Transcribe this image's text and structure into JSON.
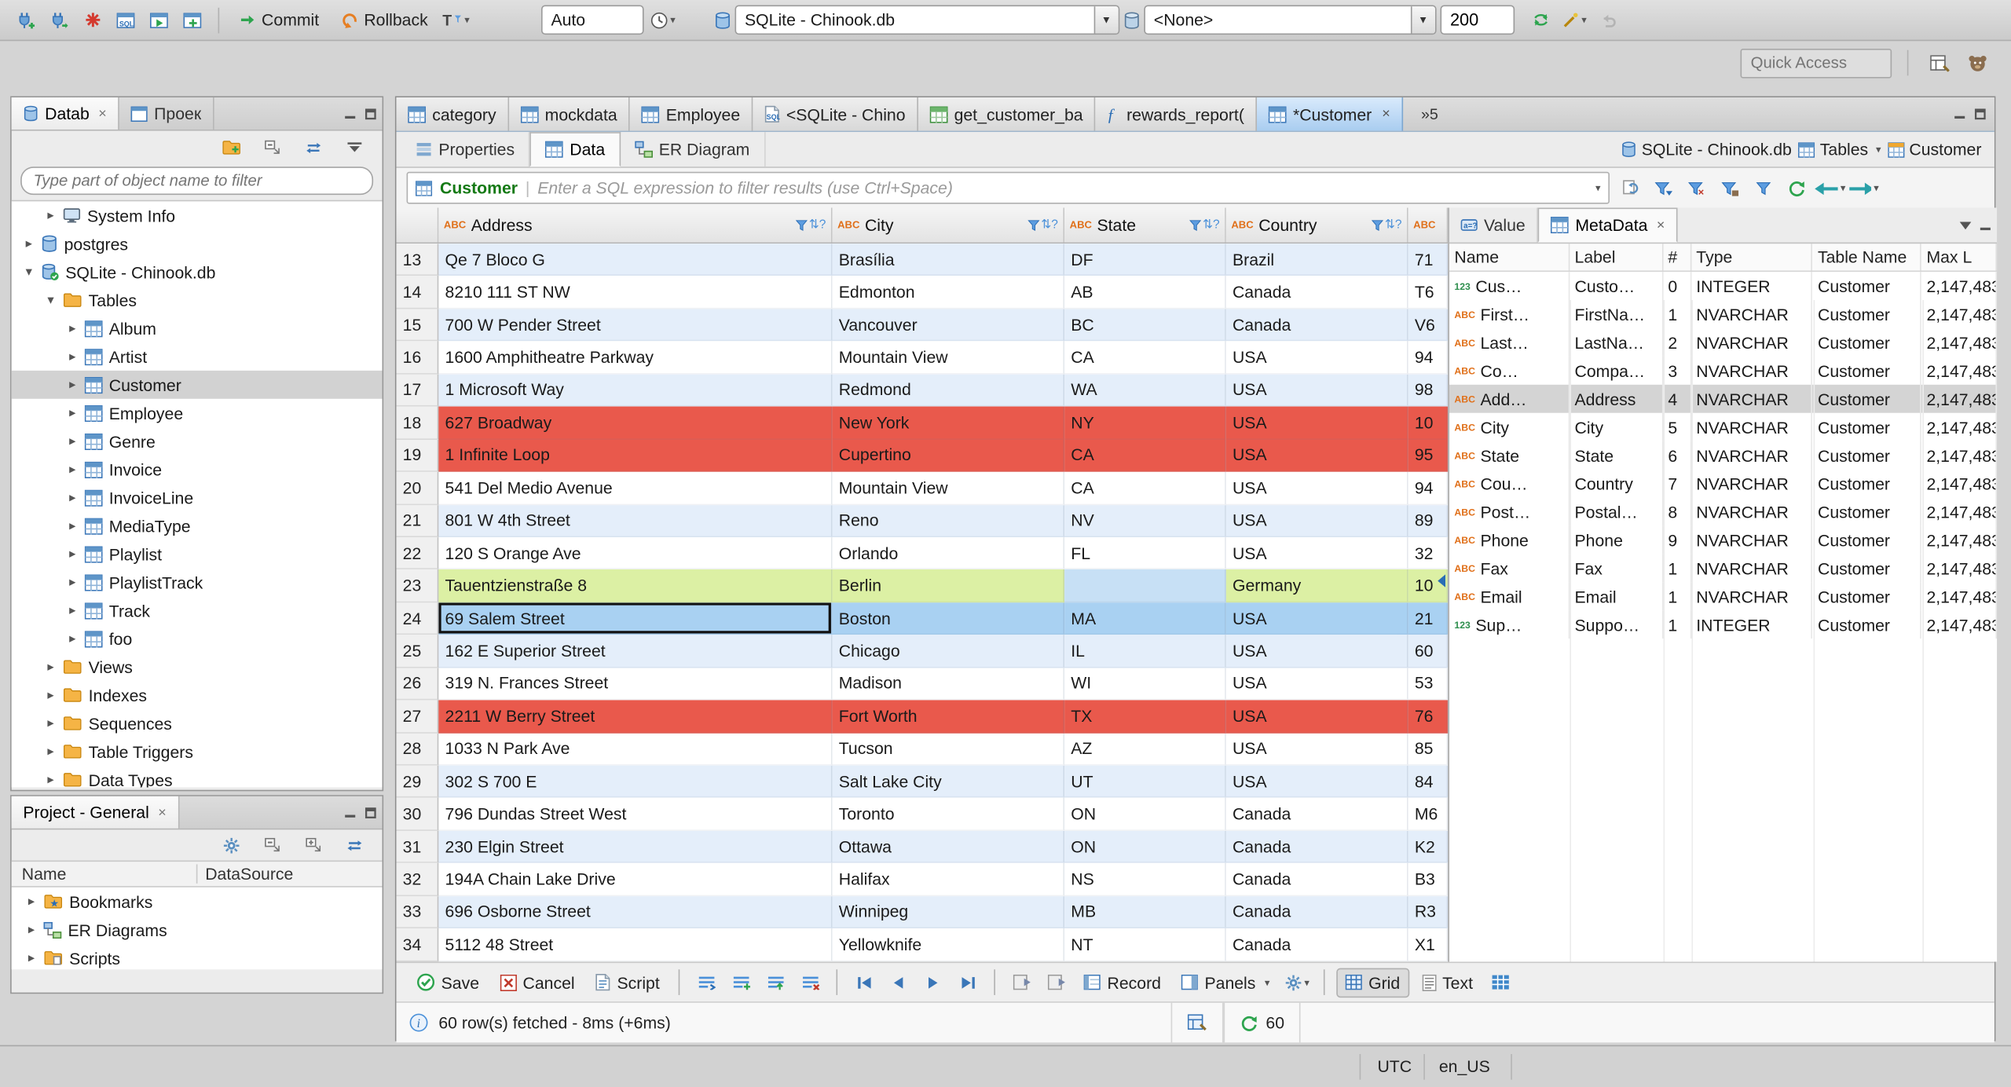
{
  "window": {
    "status": {
      "timezone": "UTC",
      "locale": "en_US"
    }
  },
  "main_toolbar": {
    "left_icons": [
      {
        "icon": "new-connection"
      },
      {
        "icon": "connect-database"
      },
      {
        "icon": "disconnect-database"
      },
      {
        "icon": "new-sql-editor"
      },
      {
        "icon": "open-recent-sql-editor"
      },
      {
        "icon": "new-sql-script"
      }
    ],
    "commit_label": "Commit",
    "rollback_label": "Rollback",
    "transaction_filter_icon": "transaction-filter",
    "auto_commit_value": "Auto",
    "transaction_log_icon": "transaction-log",
    "database_combo_value": "SQLite - Chinook.db",
    "schema_combo_value": "<None>",
    "fetch_size_value": "200",
    "right_icons": [
      {
        "icon": "sync-with-navigator"
      },
      {
        "icon": "sql-assist",
        "dropdown": true
      },
      {
        "icon": "undo",
        "disabled": true
      }
    ],
    "quick_access_placeholder": "Quick Access",
    "perspective_icons": [
      {
        "icon": "open-perspective"
      },
      {
        "icon": "dbeaver-perspective"
      }
    ]
  },
  "navigator": {
    "database_tab": "Datab",
    "projects_tab": "Проек",
    "toolbar_icons": [
      {
        "icon": "new-folder"
      },
      {
        "icon": "collapse-all"
      },
      {
        "icon": "link-with-editor"
      },
      {
        "icon": "view-menu"
      }
    ],
    "filter_placeholder": "Type part of object name to filter",
    "tree": [
      {
        "depth": 1,
        "arrow": "right",
        "icon": "system-info",
        "label": "System Info"
      },
      {
        "depth": 0,
        "arrow": "right",
        "icon": "postgres-database",
        "label": "postgres"
      },
      {
        "depth": 0,
        "arrow": "down",
        "icon": "sqlite-database",
        "label": "SQLite - Chinook.db"
      },
      {
        "depth": 1,
        "arrow": "down",
        "icon": "folder",
        "label": "Tables"
      },
      {
        "depth": 2,
        "arrow": "right",
        "icon": "table",
        "label": "Album"
      },
      {
        "depth": 2,
        "arrow": "right",
        "icon": "table",
        "label": "Artist"
      },
      {
        "depth": 2,
        "arrow": "right",
        "icon": "table",
        "label": "Customer",
        "selected": true
      },
      {
        "depth": 2,
        "arrow": "right",
        "icon": "table",
        "label": "Employee"
      },
      {
        "depth": 2,
        "arrow": "right",
        "icon": "table",
        "label": "Genre"
      },
      {
        "depth": 2,
        "arrow": "right",
        "icon": "table",
        "label": "Invoice"
      },
      {
        "depth": 2,
        "arrow": "right",
        "icon": "table",
        "label": "InvoiceLine"
      },
      {
        "depth": 2,
        "arrow": "right",
        "icon": "table",
        "label": "MediaType"
      },
      {
        "depth": 2,
        "arrow": "right",
        "icon": "table",
        "label": "Playlist"
      },
      {
        "depth": 2,
        "arrow": "right",
        "icon": "table",
        "label": "PlaylistTrack"
      },
      {
        "depth": 2,
        "arrow": "right",
        "icon": "table",
        "label": "Track"
      },
      {
        "depth": 2,
        "arrow": "right",
        "icon": "table",
        "label": "foo"
      },
      {
        "depth": 1,
        "arrow": "right",
        "icon": "folder",
        "label": "Views"
      },
      {
        "depth": 1,
        "arrow": "right",
        "icon": "folder",
        "label": "Indexes"
      },
      {
        "depth": 1,
        "arrow": "right",
        "icon": "folder",
        "label": "Sequences"
      },
      {
        "depth": 1,
        "arrow": "right",
        "icon": "folder",
        "label": "Table Triggers"
      },
      {
        "depth": 1,
        "arrow": "right",
        "icon": "folder",
        "label": "Data Types"
      }
    ]
  },
  "project_panel": {
    "title": "Project - General",
    "toolbar_icons": [
      {
        "icon": "settings"
      },
      {
        "icon": "collapse-all"
      },
      {
        "icon": "expand-all"
      },
      {
        "icon": "link-with-editor"
      }
    ],
    "columns": [
      "Name",
      "DataSource"
    ],
    "items": [
      {
        "icon": "bookmarks-folder",
        "label": "Bookmarks"
      },
      {
        "icon": "er-diagrams",
        "label": "ER Diagrams"
      },
      {
        "icon": "scripts-folder",
        "label": "Scripts"
      }
    ]
  },
  "editor": {
    "tabs": [
      {
        "icon": "table",
        "label": "category"
      },
      {
        "icon": "table",
        "label": "mockdata"
      },
      {
        "icon": "table",
        "label": "Employee"
      },
      {
        "icon": "sql",
        "label": "<SQLite - Chino"
      },
      {
        "icon": "view",
        "label": "get_customer_ba"
      },
      {
        "icon": "function",
        "label": "rewards_report("
      },
      {
        "icon": "table",
        "label": "*Customer",
        "active": true,
        "closable": true
      }
    ],
    "tab_overflow": "»5",
    "subtabs": [
      {
        "icon": "properties",
        "label": "Properties"
      },
      {
        "icon": "data",
        "label": "Data",
        "active": true
      },
      {
        "icon": "er-diagram",
        "label": "ER Diagram"
      }
    ],
    "context": {
      "database": "SQLite - Chinook.db",
      "container": "Tables",
      "entity": "Customer"
    },
    "filter": {
      "entity": "Customer",
      "placeholder": "Enter a SQL expression to filter results (use Ctrl+Space)",
      "icons": [
        {
          "icon": "expression-history"
        },
        {
          "icon": "apply-filter"
        },
        {
          "icon": "remove-filter"
        },
        {
          "icon": "save-filter"
        },
        {
          "icon": "filters-menu"
        },
        {
          "icon": "refresh-results"
        },
        {
          "icon": "results-back",
          "dropdown": true
        },
        {
          "icon": "results-forward",
          "dropdown": true
        }
      ]
    },
    "grid": {
      "columns": [
        {
          "type": "ABC",
          "name": "Address"
        },
        {
          "type": "ABC",
          "name": "City"
        },
        {
          "type": "ABC",
          "name": "State"
        },
        {
          "type": "ABC",
          "name": "Country"
        },
        {
          "type": "ABC",
          "name": ""
        }
      ],
      "rows": [
        {
          "num": 13,
          "style": "alt",
          "cells": [
            "Qe 7 Bloco G",
            "Brasília",
            "DF",
            "Brazil",
            "71"
          ]
        },
        {
          "num": 14,
          "style": "normal",
          "cells": [
            "8210 111 ST NW",
            "Edmonton",
            "AB",
            "Canada",
            "T6"
          ]
        },
        {
          "num": 15,
          "style": "alt",
          "cells": [
            "700 W Pender Street",
            "Vancouver",
            "BC",
            "Canada",
            "V6"
          ]
        },
        {
          "num": 16,
          "style": "normal",
          "cells": [
            "1600 Amphitheatre Parkway",
            "Mountain View",
            "CA",
            "USA",
            "94"
          ]
        },
        {
          "num": 17,
          "style": "alt",
          "cells": [
            "1 Microsoft Way",
            "Redmond",
            "WA",
            "USA",
            "98"
          ]
        },
        {
          "num": 18,
          "style": "red",
          "cells": [
            "627 Broadway",
            "New York",
            "NY",
            "USA",
            "10"
          ]
        },
        {
          "num": 19,
          "style": "red",
          "cells": [
            "1 Infinite Loop",
            "Cupertino",
            "CA",
            "USA",
            "95"
          ]
        },
        {
          "num": 20,
          "style": "normal",
          "cells": [
            "541 Del Medio Avenue",
            "Mountain View",
            "CA",
            "USA",
            "94"
          ]
        },
        {
          "num": 21,
          "style": "alt",
          "cells": [
            "801 W 4th Street",
            "Reno",
            "NV",
            "USA",
            "89"
          ]
        },
        {
          "num": 22,
          "style": "normal",
          "cells": [
            "120 S Orange Ave",
            "Orlando",
            "FL",
            "USA",
            "32"
          ]
        },
        {
          "num": 23,
          "style": "green",
          "cells": [
            "Tauentzienstraße 8",
            "Berlin",
            "",
            "Germany",
            "10"
          ],
          "cell_styles": {
            "2": "cell-null"
          }
        },
        {
          "num": 24,
          "style": "selected",
          "cells": [
            "69 Salem Street",
            "Boston",
            "MA",
            "USA",
            "21"
          ],
          "cell_styles": {
            "0": "cell-focus"
          }
        },
        {
          "num": 25,
          "style": "alt",
          "cells": [
            "162 E Superior Street",
            "Chicago",
            "IL",
            "USA",
            "60"
          ]
        },
        {
          "num": 26,
          "style": "normal",
          "cells": [
            "319 N. Frances Street",
            "Madison",
            "WI",
            "USA",
            "53"
          ]
        },
        {
          "num": 27,
          "style": "red",
          "cells": [
            "2211 W Berry Street",
            "Fort Worth",
            "TX",
            "USA",
            "76"
          ]
        },
        {
          "num": 28,
          "style": "normal",
          "cells": [
            "1033 N Park Ave",
            "Tucson",
            "AZ",
            "USA",
            "85"
          ]
        },
        {
          "num": 29,
          "style": "alt",
          "cells": [
            "302 S 700 E",
            "Salt Lake City",
            "UT",
            "USA",
            "84"
          ]
        },
        {
          "num": 30,
          "style": "normal",
          "cells": [
            "796 Dundas Street West",
            "Toronto",
            "ON",
            "Canada",
            "M6"
          ]
        },
        {
          "num": 31,
          "style": "alt",
          "cells": [
            "230 Elgin Street",
            "Ottawa",
            "ON",
            "Canada",
            "K2"
          ]
        },
        {
          "num": 32,
          "style": "normal",
          "cells": [
            "194A Chain Lake Drive",
            "Halifax",
            "NS",
            "Canada",
            "B3"
          ]
        },
        {
          "num": 33,
          "style": "alt",
          "cells": [
            "696 Osborne Street",
            "Winnipeg",
            "MB",
            "Canada",
            "R3"
          ]
        },
        {
          "num": 34,
          "style": "normal",
          "cells": [
            "5112 48 Street",
            "Yellowknife",
            "NT",
            "Canada",
            "X1"
          ]
        }
      ]
    },
    "side_panel": {
      "tabs": [
        {
          "icon": "value-viewer",
          "label": "Value"
        },
        {
          "icon": "metadata-grid",
          "label": "MetaData",
          "active": true,
          "closable": true
        }
      ],
      "columns": [
        "Name",
        "Label",
        "#",
        "Type",
        "Table Name",
        "Max L"
      ],
      "rows": [
        {
          "icon": "123",
          "name": "Cus…",
          "label": "Custo…",
          "num": "0",
          "type": "INTEGER",
          "table": "Customer",
          "max": "2,147,483"
        },
        {
          "icon": "ABC",
          "name": "First…",
          "label": "FirstNa…",
          "num": "1",
          "type": "NVARCHAR",
          "table": "Customer",
          "max": "2,147,483"
        },
        {
          "icon": "ABC",
          "name": "Last…",
          "label": "LastNa…",
          "num": "2",
          "type": "NVARCHAR",
          "table": "Customer",
          "max": "2,147,483"
        },
        {
          "icon": "ABC",
          "name": "Co…",
          "label": "Compa…",
          "num": "3",
          "type": "NVARCHAR",
          "table": "Customer",
          "max": "2,147,483"
        },
        {
          "icon": "ABC",
          "name": "Add…",
          "label": "Address",
          "num": "4",
          "type": "NVARCHAR",
          "table": "Customer",
          "max": "2,147,483",
          "selected": true
        },
        {
          "icon": "ABC",
          "name": "City",
          "label": "City",
          "num": "5",
          "type": "NVARCHAR",
          "table": "Customer",
          "max": "2,147,483"
        },
        {
          "icon": "ABC",
          "name": "State",
          "label": "State",
          "num": "6",
          "type": "NVARCHAR",
          "table": "Customer",
          "max": "2,147,483"
        },
        {
          "icon": "ABC",
          "name": "Cou…",
          "label": "Country",
          "num": "7",
          "type": "NVARCHAR",
          "table": "Customer",
          "max": "2,147,483"
        },
        {
          "icon": "ABC",
          "name": "Post…",
          "label": "Postal…",
          "num": "8",
          "type": "NVARCHAR",
          "table": "Customer",
          "max": "2,147,483"
        },
        {
          "icon": "ABC",
          "name": "Phone",
          "label": "Phone",
          "num": "9",
          "type": "NVARCHAR",
          "table": "Customer",
          "max": "2,147,483"
        },
        {
          "icon": "ABC",
          "name": "Fax",
          "label": "Fax",
          "num": "1",
          "type": "NVARCHAR",
          "table": "Customer",
          "max": "2,147,483"
        },
        {
          "icon": "ABC",
          "name": "Email",
          "label": "Email",
          "num": "1",
          "type": "NVARCHAR",
          "table": "Customer",
          "max": "2,147,483"
        },
        {
          "icon": "123",
          "name": "Sup…",
          "label": "Suppo…",
          "num": "1",
          "type": "INTEGER",
          "table": "Customer",
          "max": "2,147,483"
        }
      ]
    },
    "result_toolbar": {
      "items": [
        {
          "type": "button",
          "icon": "save",
          "label": "Save"
        },
        {
          "type": "button",
          "icon": "cancel",
          "label": "Cancel"
        },
        {
          "type": "button",
          "icon": "script",
          "label": "Script"
        },
        {
          "type": "sep"
        },
        {
          "type": "icon",
          "icon": "edit-value"
        },
        {
          "type": "icon",
          "icon": "add-row"
        },
        {
          "type": "icon",
          "icon": "duplicate-row"
        },
        {
          "type": "icon",
          "icon": "delete-row"
        },
        {
          "type": "sep"
        },
        {
          "type": "icon",
          "icon": "first-row"
        },
        {
          "type": "icon",
          "icon": "previous-row"
        },
        {
          "type": "icon",
          "icon": "next-row"
        },
        {
          "type": "icon",
          "icon": "last-row"
        },
        {
          "type": "sep"
        },
        {
          "type": "icon",
          "icon": "fetch-next-page"
        },
        {
          "type": "icon",
          "icon": "fetch-all-rows"
        },
        {
          "type": "button",
          "icon": "record",
          "label": "Record"
        },
        {
          "type": "button",
          "icon": "panels",
          "label": "Panels",
          "dropdown": true
        },
        {
          "type": "icon",
          "icon": "result-settings",
          "dropdown": true
        },
        {
          "type": "sep"
        },
        {
          "type": "toggle",
          "icon": "grid-view",
          "label": "Grid",
          "active": true
        },
        {
          "type": "toggle",
          "icon": "text-view",
          "label": "Text"
        },
        {
          "type": "icon",
          "icon": "grid-extra"
        }
      ]
    },
    "status": {
      "message": "60 row(s) fetched - 8ms (+6ms)",
      "auto_refresh_value": "60"
    }
  }
}
